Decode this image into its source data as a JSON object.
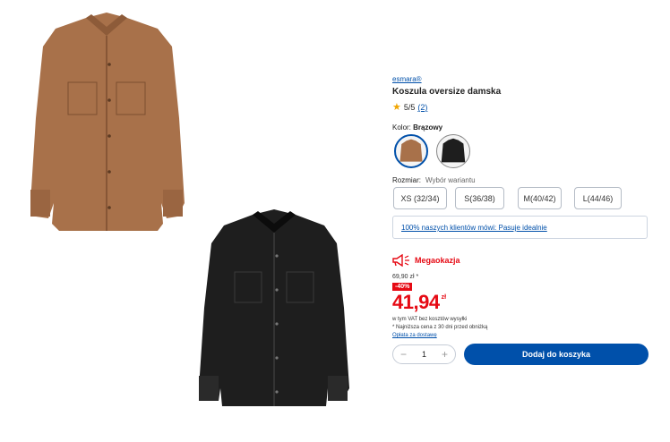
{
  "product": {
    "brand": "esmara®",
    "title": "Koszula oversize damska",
    "rating_value": "5/5",
    "rating_count": "(2)"
  },
  "color": {
    "label": "Kolor:",
    "selected": "Brązowy",
    "swatches": [
      {
        "name": "brown",
        "hex": "#a8714a"
      },
      {
        "name": "black",
        "hex": "#1e1e1e"
      }
    ]
  },
  "size": {
    "label": "Rozmiar:",
    "hint": "Wybór wariantu",
    "options": [
      "XS (32/34)",
      "S(36/38)",
      "M(40/42)",
      "L(44/46)"
    ]
  },
  "fit_note": "100% naszych klientów mówi: Pasuje idealnie",
  "promo": {
    "label": "Megaokazja",
    "old_price": "69,90 zł *",
    "discount": "-40%",
    "price": "41,94",
    "currency": "zł",
    "vat_note": "w tym VAT bez kosztów wysyłki",
    "lowest_note": "* Najniższa cena z 30 dni przed obniżką",
    "shipping_link": "Opłata za dostawę"
  },
  "cart": {
    "quantity": "1",
    "minus": "−",
    "plus": "+",
    "add_label": "Dodaj do koszyka"
  },
  "colors": {
    "accent": "#0050aa",
    "sale": "#e60a14",
    "star": "#f0a500"
  }
}
